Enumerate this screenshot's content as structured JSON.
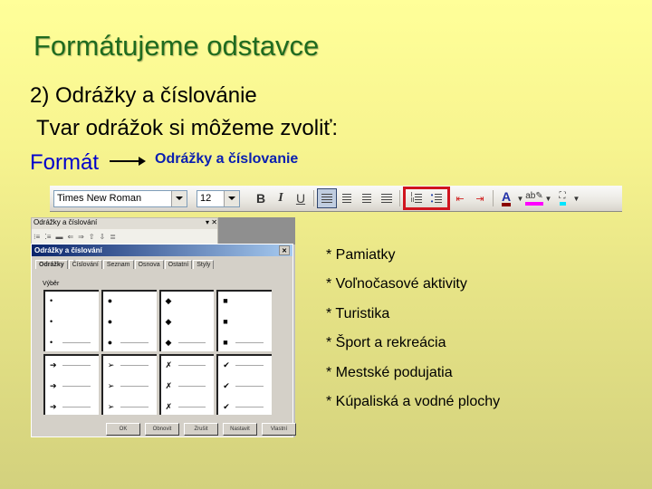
{
  "slide": {
    "title": "Formátujeme odstavce",
    "line1": "2) Odrážky a číslovánie",
    "line2": "Tvar odrážok si môžeme zvoliť:",
    "menu_root": "Formát",
    "menu_path": "Odrážky a číslovanie"
  },
  "toolbar": {
    "font_name": "Times New Roman",
    "font_size": "12",
    "bold": "B",
    "italic": "I",
    "underline": "U",
    "highlight_color": "#d0141e",
    "font_color": "#8b0000",
    "highlight_marker_color": "#ff00ff",
    "shading_color": "#00e5ff"
  },
  "dialog": {
    "float_toolbar_title": "Odrážky a číslování",
    "title": "Odrážky a číslování",
    "tabs": [
      "Odrážky",
      "Číslování",
      "Seznam",
      "Osnova",
      "Ostatní",
      "Styly"
    ],
    "group_label": "Výběr",
    "bullet_sets": [
      [
        "•",
        "•",
        "•"
      ],
      [
        "●",
        "●",
        "●"
      ],
      [
        "◆",
        "◆",
        "◆"
      ],
      [
        "■",
        "■",
        "■"
      ],
      [
        "➔",
        "➔",
        "➔"
      ],
      [
        "➢",
        "➢",
        "➢"
      ],
      [
        "✗",
        "✗",
        "✗"
      ],
      [
        "✔",
        "✔",
        "✔"
      ]
    ],
    "buttons": [
      "OK",
      "Obnovit",
      "Zrušit",
      "Nastavit",
      "Vlastní"
    ]
  },
  "list": {
    "items": [
      "* Pamiatky",
      "* Voľnočasové aktivity",
      "* Turistika",
      "* Šport a rekreácia",
      "* Mestské podujatia",
      "* Kúpaliská a vodné plochy"
    ]
  }
}
